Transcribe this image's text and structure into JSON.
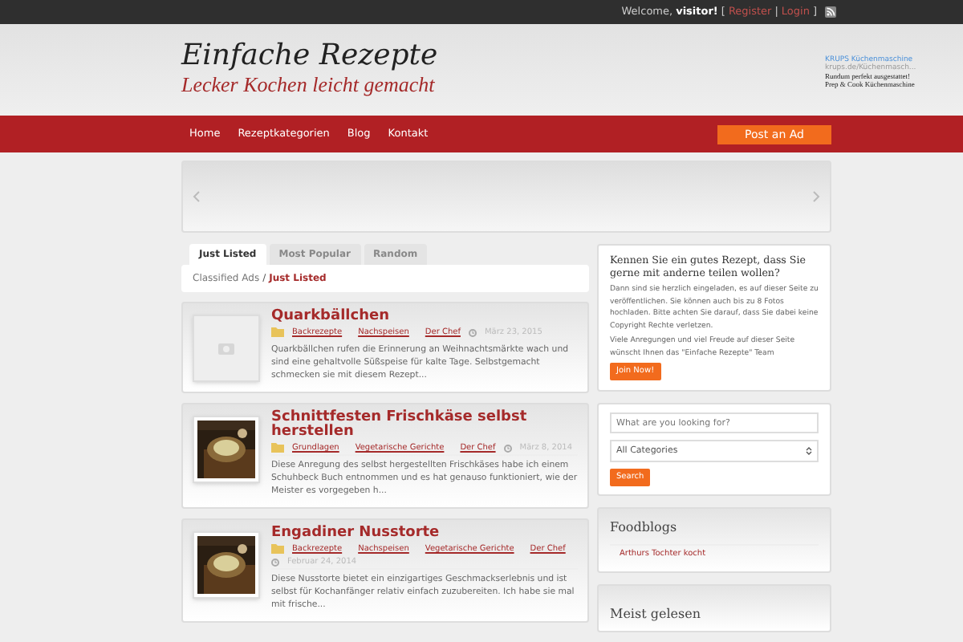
{
  "top_bar": {
    "welcome": "Welcome,",
    "user": "visitor!",
    "open_bracket": "[",
    "links": [
      "Register",
      "Login"
    ],
    "separator": "|",
    "close_bracket": "]"
  },
  "header": {
    "title": "Einfache Rezepte",
    "tagline": "Lecker Kochen leicht gemacht"
  },
  "ad": {
    "title": "KRUPS Küchenmaschine",
    "url": "krups.de/Küchenmasch...",
    "body": "Rundum perfekt ausgestattet! Prep & Cook Küchenmaschine"
  },
  "nav": {
    "items": [
      "Home",
      "Rezeptkategorien",
      "Blog",
      "Kontakt"
    ],
    "cta": "Post an Ad"
  },
  "tabs": [
    {
      "label": "Just Listed",
      "selected": true
    },
    {
      "label": "Most Popular",
      "selected": false
    },
    {
      "label": "Random",
      "selected": false
    }
  ],
  "breadcrumb": {
    "root": "Classified Ads",
    "separator": "/",
    "current": "Just Listed"
  },
  "listings": [
    {
      "title": "Quarkbällchen",
      "kind": "placeholder",
      "categories": [
        "Backrezepte",
        "Nachspeisen"
      ],
      "author": "Der Chef",
      "date": "März 23, 2015",
      "excerpt": "Quarkbällchen rufen die Erinnerung an Weihnachtsmärkte wach und sind eine gehaltvolle Süßspeise für kalte Tage. Selbstgemacht schmecken sie mit diesem Rezept..."
    },
    {
      "title": "Schnittfesten Frischkäse selbst herstellen",
      "categories": [
        "Grundlagen",
        "Vegetarische Gerichte"
      ],
      "author": "Der Chef",
      "date": "März 8, 2014",
      "excerpt": "Diese Anregung des selbst hergestellten Frischkäses habe ich einem Schuhbeck Buch entnommen und es hat genauso funktioniert, wie der Meister es vorgegeben h..."
    },
    {
      "title": "Engadiner Nusstorte",
      "categories": [
        "Backrezepte",
        "Nachspeisen",
        "Vegetarische Gerichte"
      ],
      "author": "Der Chef",
      "date": "Februar 24, 2014",
      "excerpt": "Diese Nusstorte bietet ein einzigartiges Geschmackserlebnis und ist selbst für Kochanfänger relativ einfach zuzubereiten. Ich habe sie mal mit frische..."
    }
  ],
  "promo": {
    "heading": "Kennen Sie ein gutes Rezept, dass Sie gerne mit anderne teilen wollen?",
    "paragraphs": [
      "Dann sind sie herzlich eingeladen, es auf dieser Seite zu veröffentlichen. Sie können auch bis zu 8 Fotos hochladen. Bitte achten Sie darauf, dass Sie dabei keine Copyright Rechte verletzen.",
      "Viele Anregungen und viel Freude auf dieser Seite wünscht Ihnen das \"Einfache Rezepte\" Team"
    ],
    "button": "Join Now!"
  },
  "search": {
    "placeholder": "What are you looking for?",
    "category": "All Categories",
    "button": "Search"
  },
  "foodblogs": {
    "heading": "Foodblogs",
    "items": [
      "Arthurs Tochter kocht"
    ]
  },
  "most_read": {
    "heading": "Meist gelesen"
  }
}
